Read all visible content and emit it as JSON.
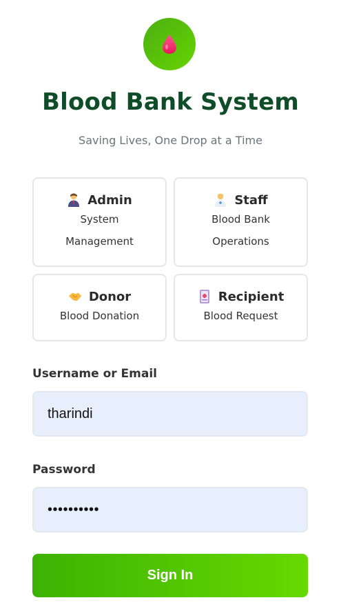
{
  "app": {
    "title": "Blood Bank System",
    "subtitle": "Saving Lives, One Drop at a Time",
    "logo_icon": "blood-drop-icon"
  },
  "roles": [
    {
      "name": "Admin",
      "description": "System Management",
      "icon": "admin-person-icon"
    },
    {
      "name": "Staff",
      "description": "Blood Bank Operations",
      "icon": "health-worker-icon"
    },
    {
      "name": "Donor",
      "description": "Blood Donation",
      "icon": "handshake-icon"
    },
    {
      "name": "Recipient",
      "description": "Blood Request",
      "icon": "medical-file-icon"
    }
  ],
  "form": {
    "username_label": "Username or Email",
    "username_value": "tharindi",
    "password_label": "Password",
    "password_value": "••••••••••",
    "submit_label": "Sign In"
  },
  "colors": {
    "accent_green": "#4caf13",
    "title_green": "#0e4d27",
    "input_bg": "#e8effc"
  }
}
